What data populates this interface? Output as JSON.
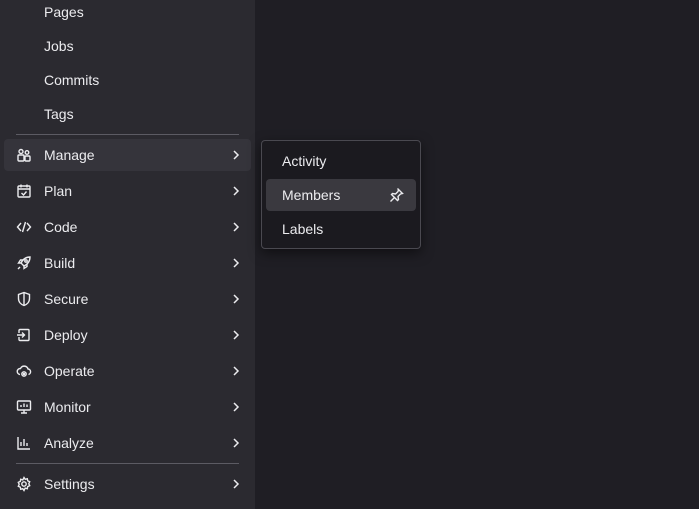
{
  "sidebar": {
    "sub_items": [
      {
        "label": "Pages"
      },
      {
        "label": "Jobs"
      },
      {
        "label": "Commits"
      },
      {
        "label": "Tags"
      }
    ],
    "nav_items": [
      {
        "label": "Manage",
        "icon": "users-icon",
        "active": true
      },
      {
        "label": "Plan",
        "icon": "calendar-check-icon"
      },
      {
        "label": "Code",
        "icon": "code-icon"
      },
      {
        "label": "Build",
        "icon": "rocket-icon"
      },
      {
        "label": "Secure",
        "icon": "shield-icon"
      },
      {
        "label": "Deploy",
        "icon": "deploy-icon"
      },
      {
        "label": "Operate",
        "icon": "cloud-gear-icon"
      },
      {
        "label": "Monitor",
        "icon": "monitor-chart-icon"
      },
      {
        "label": "Analyze",
        "icon": "bar-chart-icon"
      }
    ],
    "settings": {
      "label": "Settings",
      "icon": "gear-icon"
    }
  },
  "flyout": {
    "items": [
      {
        "label": "Activity"
      },
      {
        "label": "Members",
        "pinned_icon": "pin-icon"
      },
      {
        "label": "Labels"
      }
    ]
  },
  "colors": {
    "sidebar_bg": "#2b2a30",
    "main_bg": "#1f1e24",
    "text": "#ececef",
    "flyout_bg": "#1b1a1f"
  }
}
